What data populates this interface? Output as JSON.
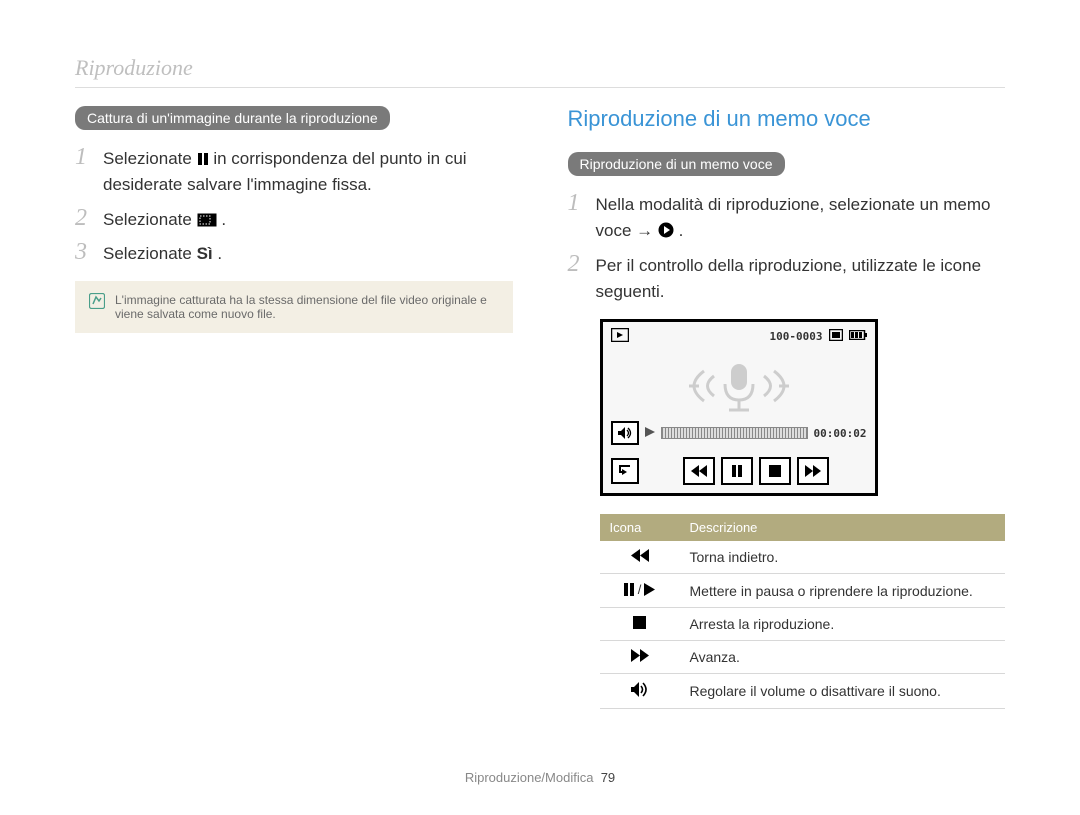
{
  "header": {
    "title": "Riproduzione"
  },
  "left": {
    "pill": "Cattura di un'immagine durante la riproduzione",
    "steps": [
      {
        "n": "1",
        "pre": "Selezionate ",
        "post": " in corrispondenza del punto in cui desiderate salvare l'immagine fissa.",
        "icon": "pause-icon"
      },
      {
        "n": "2",
        "pre": "Selezionate ",
        "post": ".",
        "icon": "crop-icon"
      },
      {
        "n": "3",
        "pre": "Selezionate ",
        "bold": "Sì",
        "post": " ."
      }
    ],
    "note": "L'immagine catturata ha la stessa dimensione del file video originale e viene salvata come nuovo file."
  },
  "right": {
    "title": "Riproduzione di un memo voce",
    "pill": "Riproduzione di un memo voce",
    "steps": [
      {
        "n": "1",
        "pre": "Nella modalità di riproduzione, selezionate un memo voce → ",
        "post": ".",
        "icon": "play-circle-icon"
      },
      {
        "n": "2",
        "pre": "Per il controllo della riproduzione, utilizzate le icone seguenti."
      }
    ],
    "screen": {
      "file_label": "100-0003",
      "time": "00:00:02"
    },
    "table": {
      "headers": [
        "Icona",
        "Descrizione"
      ],
      "rows": [
        {
          "icon": "rewind-icon",
          "desc": "Torna indietro."
        },
        {
          "icon": "pause-play-icon",
          "desc": "Mettere in pausa o riprendere la riproduzione."
        },
        {
          "icon": "stop-icon",
          "desc": "Arresta la riproduzione."
        },
        {
          "icon": "forward-icon",
          "desc": "Avanza."
        },
        {
          "icon": "volume-icon",
          "desc": "Regolare il volume o disattivare il suono."
        }
      ]
    }
  },
  "footer": {
    "section": "Riproduzione/Modifica",
    "page": "79"
  }
}
